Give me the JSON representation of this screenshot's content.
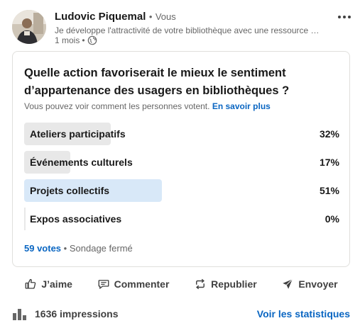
{
  "author": {
    "name": "Ludovic Piquemal",
    "separator": "•",
    "badge": "Vous",
    "headline": "Je développe l'attractivité de votre bibliothèque avec une ressource …",
    "time": "1 mois",
    "visibility_icon": "globe-icon"
  },
  "poll": {
    "question": "Quelle action favoriserait le mieux le sentiment d’appartenance des usagers en bibliothèques ?",
    "voters_note": "Vous pouvez voir comment les personnes votent.",
    "learn_more": "En savoir plus",
    "options": [
      {
        "label": "Ateliers participatifs",
        "percent": "32%",
        "fraction": 0.32,
        "selected": false
      },
      {
        "label": "Événements culturels",
        "percent": "17%",
        "fraction": 0.17,
        "selected": false
      },
      {
        "label": "Projets collectifs",
        "percent": "51%",
        "fraction": 0.51,
        "selected": true
      },
      {
        "label": "Expos associatives",
        "percent": "0%",
        "fraction": 0,
        "selected": false
      }
    ],
    "votes": "59 votes",
    "status_separator": "•",
    "status": "Sondage fermé"
  },
  "actions": {
    "like": "J’aime",
    "comment": "Commenter",
    "repost": "Republier",
    "send": "Envoyer"
  },
  "stats": {
    "impressions": "1636 impressions",
    "see_stats": "Voir les statistiques"
  },
  "colors": {
    "link": "#0a66c2",
    "bar": "#e8e8e8",
    "bar_selected": "#d8e8f8",
    "text_secondary": "#666666"
  }
}
